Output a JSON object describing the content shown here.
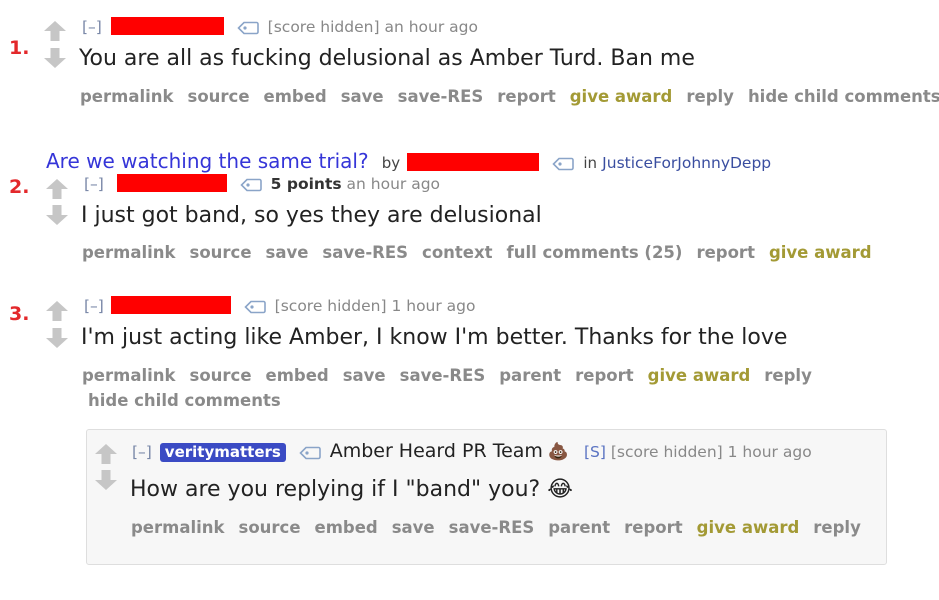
{
  "comments": [
    {
      "number": "1.",
      "collapse": "[–]",
      "score": "[score hidden]",
      "time": "an hour ago",
      "body": "You are all as fucking delusional as Amber Turd. Ban me",
      "links": [
        "permalink",
        "source",
        "embed",
        "save",
        "save-RES",
        "report"
      ],
      "award": "give award",
      "links_after": [
        "reply",
        "hide child comments"
      ]
    },
    {
      "number": "2.",
      "post_title": "Are we watching the same trial?",
      "by": "by",
      "in_label": "in",
      "subreddit": "JusticeForJohnnyDepp",
      "collapse": "[–]",
      "points": "5 points",
      "time": "an hour ago",
      "body": "I just got band, so yes they are delusional",
      "links": [
        "permalink",
        "source",
        "save",
        "save-RES",
        "context",
        "full comments (25)",
        "report"
      ],
      "award": "give award"
    },
    {
      "number": "3.",
      "collapse": "[–]",
      "score": "[score hidden]",
      "time": "1 hour ago",
      "body": "I'm just acting like Amber, I know I'm better. Thanks for the love",
      "links": [
        "permalink",
        "source",
        "embed",
        "save",
        "save-RES",
        "parent",
        "report"
      ],
      "award": "give award",
      "links_after": [
        "reply"
      ],
      "links_line2": [
        "hide child comments"
      ]
    }
  ],
  "reply": {
    "collapse": "[–]",
    "username": "veritymatters",
    "flair": "Amber Heard PR Team",
    "flair_emoji": "💩",
    "submitter_tag": "[S]",
    "score": "[score hidden]",
    "time": "1 hour ago",
    "body": "How are you replying if I \"band\" you?",
    "emoji": "😂",
    "links": [
      "permalink",
      "source",
      "embed",
      "save",
      "save-RES",
      "parent",
      "report"
    ],
    "award": "give award",
    "links_after": [
      "reply"
    ]
  },
  "colors": {
    "number": "#e3282b",
    "redaction": "#ff0000",
    "award": "#a39a35",
    "title_link": "#3535d8",
    "badge": "#3b4bc4"
  }
}
